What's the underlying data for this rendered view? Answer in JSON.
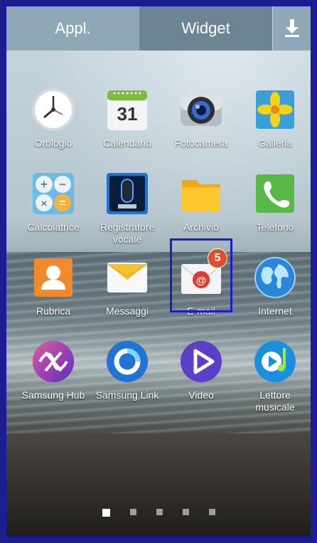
{
  "tabs": {
    "appl": "Appl.",
    "widget": "Widget",
    "download_icon": "download-icon"
  },
  "apps": [
    {
      "label": "Orologio",
      "icon": "clock-icon"
    },
    {
      "label": "Calendario",
      "icon": "calendar-icon",
      "day": "31"
    },
    {
      "label": "Fotocamera",
      "icon": "camera-icon"
    },
    {
      "label": "Galleria",
      "icon": "gallery-icon"
    },
    {
      "label": "Calcolatrice",
      "icon": "calculator-icon"
    },
    {
      "label": "Registratore",
      "label_line2": "vocale",
      "icon": "microphone-icon"
    },
    {
      "label": "Archivio",
      "icon": "folder-icon"
    },
    {
      "label": "Telefono",
      "icon": "phone-icon"
    },
    {
      "label": "Rubrica",
      "icon": "contacts-icon"
    },
    {
      "label": "Messaggi",
      "icon": "messages-icon"
    },
    {
      "label": "E-mail",
      "icon": "email-icon",
      "badge": "5"
    },
    {
      "label": "Internet",
      "icon": "globe-icon"
    },
    {
      "label": "Samsung Hub",
      "icon": "samsung-hub-icon"
    },
    {
      "label": "Samsung Link",
      "icon": "samsung-link-icon"
    },
    {
      "label": "Video",
      "icon": "video-icon"
    },
    {
      "label": "Lettore",
      "label_line2": "musicale",
      "icon": "music-player-icon"
    }
  ],
  "page_indicator": {
    "count": 5,
    "active_index": 0
  }
}
